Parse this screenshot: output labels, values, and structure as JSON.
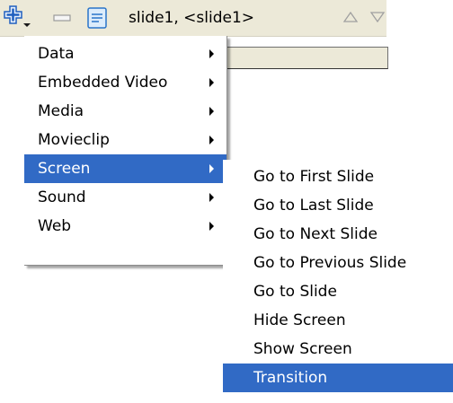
{
  "toolbar": {
    "title": "slide1, <slide1>",
    "icons": {
      "add": "add-behavior-icon",
      "remove": "remove-behavior-icon",
      "script": "script-icon",
      "move_up": "move-up-icon",
      "move_down": "move-down-icon"
    }
  },
  "menu": {
    "items": [
      {
        "label": "Data"
      },
      {
        "label": "Embedded Video"
      },
      {
        "label": "Media"
      },
      {
        "label": "Movieclip"
      },
      {
        "label": "Screen"
      },
      {
        "label": "Sound"
      },
      {
        "label": "Web"
      }
    ]
  },
  "submenu": {
    "items": [
      {
        "label": "Go to First Slide"
      },
      {
        "label": "Go to Last Slide"
      },
      {
        "label": "Go to Next Slide"
      },
      {
        "label": "Go to Previous Slide"
      },
      {
        "label": "Go to Slide"
      },
      {
        "label": "Hide Screen"
      },
      {
        "label": "Show Screen"
      },
      {
        "label": "Transition"
      }
    ]
  },
  "colors": {
    "toolbar_bg": "#ece9d8",
    "highlight_bg": "#316ac5",
    "highlight_text": "#ffffff",
    "plus_icon_blue": "#1f5fbf"
  }
}
